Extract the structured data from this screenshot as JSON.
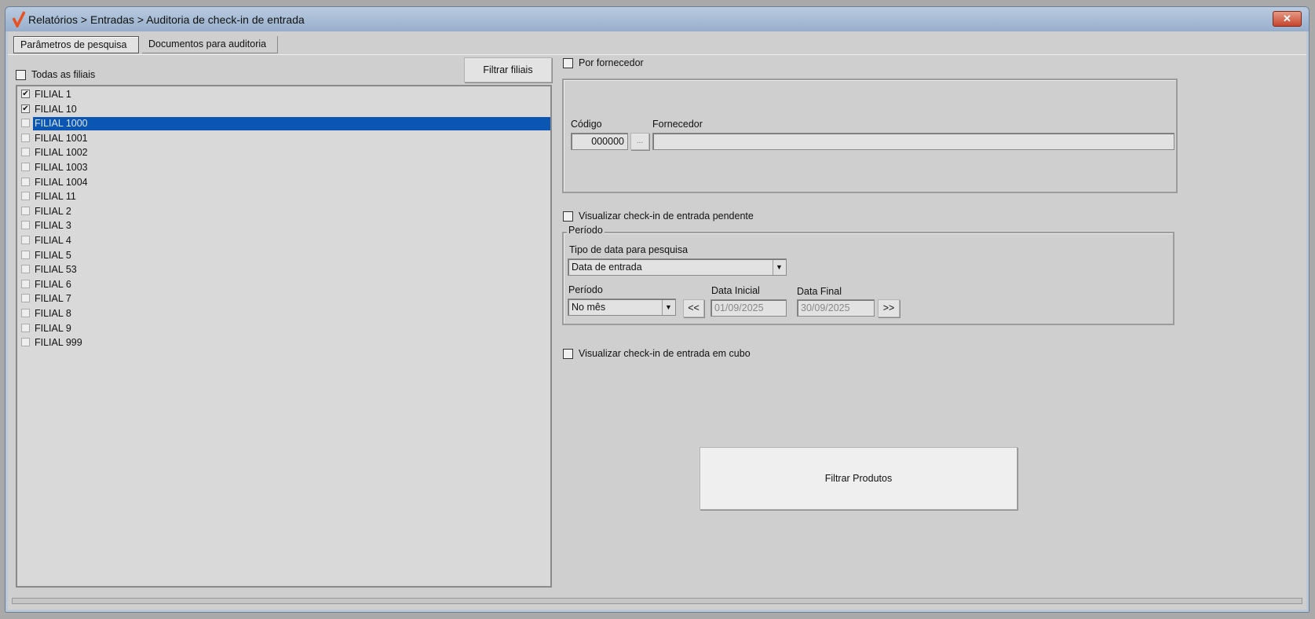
{
  "window": {
    "title": "Relatórios > Entradas > Auditoria de check-in de entrada",
    "close_label": "✕"
  },
  "tabs": [
    {
      "label": "Parâmetros de pesquisa"
    },
    {
      "label": "Documentos para auditoria"
    }
  ],
  "branches": {
    "all_label": "Todas as filiais",
    "filter_button": "Filtrar filiais",
    "items": [
      {
        "label": "FILIAL 1",
        "checked": true
      },
      {
        "label": "FILIAL 10",
        "checked": true
      },
      {
        "label": "FILIAL 1000",
        "checked": false,
        "selected": true
      },
      {
        "label": "FILIAL 1001",
        "checked": false
      },
      {
        "label": "FILIAL 1002",
        "checked": false
      },
      {
        "label": "FILIAL 1003",
        "checked": false
      },
      {
        "label": "FILIAL 1004",
        "checked": false
      },
      {
        "label": "FILIAL 11",
        "checked": false
      },
      {
        "label": "FILIAL 2",
        "checked": false
      },
      {
        "label": "FILIAL 3",
        "checked": false
      },
      {
        "label": "FILIAL 4",
        "checked": false
      },
      {
        "label": "FILIAL 5",
        "checked": false
      },
      {
        "label": "FILIAL 53",
        "checked": false
      },
      {
        "label": "FILIAL 6",
        "checked": false
      },
      {
        "label": "FILIAL 7",
        "checked": false
      },
      {
        "label": "FILIAL 8",
        "checked": false
      },
      {
        "label": "FILIAL 9",
        "checked": false
      },
      {
        "label": "FILIAL 999",
        "checked": false
      }
    ]
  },
  "supplier": {
    "checkbox_label": "Por fornecedor",
    "code_label": "Código",
    "code_value": "000000",
    "lookup_label": "...",
    "name_label": "Fornecedor",
    "name_value": ""
  },
  "pending_label": "Visualizar check-in de entrada pendente",
  "period": {
    "group_label": "Período",
    "date_type_label": "Tipo de data para pesquisa",
    "date_type_value": "Data de entrada",
    "period_label": "Período",
    "period_value": "No mês",
    "prev_label": "<<",
    "start_label": "Data Inicial",
    "start_value": "01/09/2025",
    "end_label": "Data Final",
    "end_value": "30/09/2025",
    "next_label": ">>"
  },
  "cube_label": "Visualizar check-in de entrada em cubo",
  "filter_products_button": "Filtrar Produtos"
}
